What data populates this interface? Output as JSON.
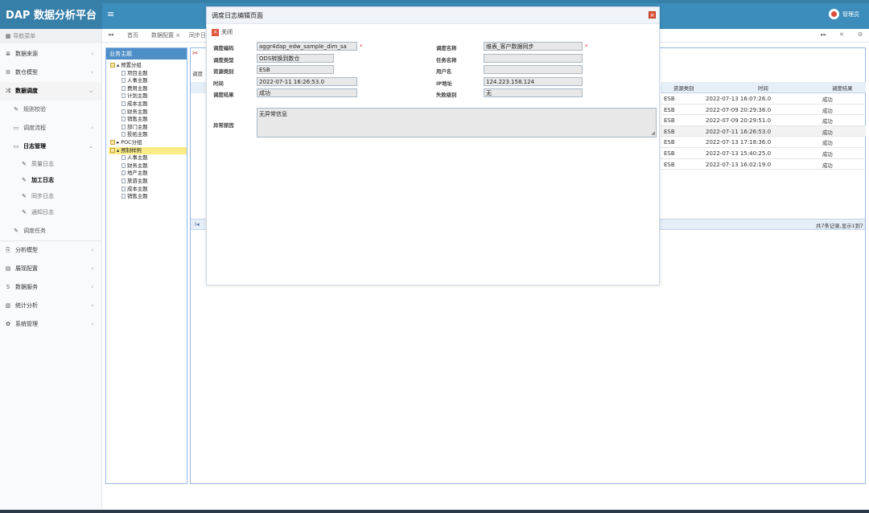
{
  "header": {
    "app_title": "DAP 数据分析平台",
    "menu_toggle": "≡",
    "user_name": "管理员"
  },
  "sidebar": {
    "section_title": "导航菜单",
    "items": [
      {
        "icon": "≣",
        "label": "数据来源",
        "chev": "‹"
      },
      {
        "icon": "⚙",
        "label": "数仓模型",
        "chev": "‹"
      },
      {
        "icon": "⤮",
        "label": "数据调度",
        "chev": "⌄"
      }
    ],
    "sub_items": [
      {
        "icon": "✎",
        "label": "规则校验",
        "chev": ""
      },
      {
        "icon": "▭",
        "label": "调度流程",
        "chev": "‹"
      },
      {
        "icon": "▭",
        "label": "日志管理",
        "chev": "⌄"
      }
    ],
    "log_items": [
      {
        "label": "质量日志"
      },
      {
        "label": "加工日志"
      },
      {
        "label": "同步日志"
      },
      {
        "label": "通知日志"
      }
    ],
    "task_item": {
      "label": "调度任务"
    },
    "lower_items": [
      {
        "icon": "⎘",
        "label": "分析模型",
        "chev": "‹"
      },
      {
        "icon": "▤",
        "label": "展现配置",
        "chev": "‹"
      },
      {
        "icon": "S",
        "label": "数据服务",
        "chev": "‹"
      },
      {
        "icon": "▥",
        "label": "统计分析",
        "chev": "‹"
      },
      {
        "icon": "✿",
        "label": "系统管理",
        "chev": "‹"
      }
    ]
  },
  "tabs": {
    "prev": "◂◂",
    "items": [
      "首页",
      "数据配置 ×",
      "同步日"
    ],
    "next": "▸▸",
    "fullscreen": "✕",
    "settings": "⚙"
  },
  "tree": {
    "title": "业务主题",
    "rows": [
      {
        "indent": 0,
        "type": "folder",
        "label": "▴ 预置分组"
      },
      {
        "indent": 1,
        "type": "doc",
        "label": "项目主题"
      },
      {
        "indent": 1,
        "type": "doc",
        "label": "人事主题"
      },
      {
        "indent": 1,
        "type": "doc",
        "label": "费用主题"
      },
      {
        "indent": 1,
        "type": "doc",
        "label": "计划主题"
      },
      {
        "indent": 1,
        "type": "doc",
        "label": "成本主题"
      },
      {
        "indent": 1,
        "type": "doc",
        "label": "财务主题"
      },
      {
        "indent": 1,
        "type": "doc",
        "label": "销售主题"
      },
      {
        "indent": 1,
        "type": "doc",
        "label": "部门主题"
      },
      {
        "indent": 1,
        "type": "doc",
        "label": "投拓主题"
      },
      {
        "indent": 0,
        "type": "folder",
        "label": "▸ POC分组"
      },
      {
        "indent": 0,
        "type": "folder",
        "label": "▴ 预制样例",
        "selected": true
      },
      {
        "indent": 1,
        "type": "doc",
        "label": "人事主题"
      },
      {
        "indent": 1,
        "type": "doc",
        "label": "财务主题"
      },
      {
        "indent": 1,
        "type": "doc",
        "label": "地产主题"
      },
      {
        "indent": 1,
        "type": "doc",
        "label": "旅游主题"
      },
      {
        "indent": 1,
        "type": "doc",
        "label": "成本主题"
      },
      {
        "indent": 1,
        "type": "doc",
        "label": "销售主题"
      }
    ]
  },
  "main": {
    "subtab": "调度",
    "grid": {
      "columns": [
        "资源类别",
        "时间",
        "调度结果"
      ],
      "rows": [
        [
          "ESB",
          "2022-07-13 16:07:26.0",
          "成功"
        ],
        [
          "ESB",
          "2022-07-09 20:29:38.0",
          "成功"
        ],
        [
          "ESB",
          "2022-07-09 20:29:51.0",
          "成功"
        ],
        [
          "ESB",
          "2022-07-11 16:26:53.0",
          "成功"
        ],
        [
          "ESB",
          "2022-07-13 17:18:36.0",
          "成功"
        ],
        [
          "ESB",
          "2022-07-13 15:40:25.0",
          "成功"
        ],
        [
          "ESB",
          "2022-07-13 16:02:19.0",
          "成功"
        ]
      ]
    },
    "pager": {
      "first": "I◂",
      "info": "共7条记录,显示1到7"
    }
  },
  "dialog": {
    "title": "调度日志编辑页面",
    "close_glyph": "×",
    "toolbar_close": "关闭",
    "fields": {
      "code_label": "调度编码",
      "code_value": "aggr4dap_edw_sample_dim_sa",
      "name_label": "调度名称",
      "name_value": "维表_客户数据同步",
      "type_label": "调度类型",
      "type_value": "ODS转换到数仓",
      "task_label": "任务名称",
      "task_value": "",
      "resource_label": "资源类别",
      "resource_value": "ESB",
      "user_label": "用户名",
      "user_value": "",
      "time_label": "时间",
      "time_value": "2022-07-11 16:26:53.0",
      "ip_label": "IP地址",
      "ip_value": "124.223.158.124",
      "result_label": "调度结果",
      "result_value": "成功",
      "fail_label": "失败级别",
      "fail_value": "无",
      "error_label": "异常原因",
      "error_value": "无异常信息"
    },
    "required_mark": "*"
  }
}
